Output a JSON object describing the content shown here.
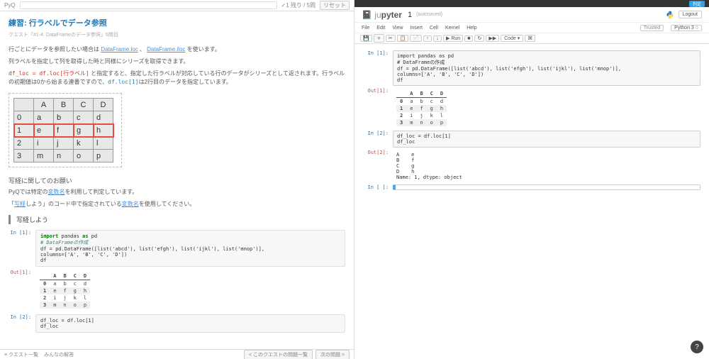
{
  "left": {
    "logo": "PyQ",
    "progress": "1 残り / 5問",
    "reset": "リセット",
    "title": "練習: 行ラベルでデータ参照",
    "breadcrumb": "クエスト「#1-4. DataFrameのデータ参照」5問目",
    "p1_pre": "行ごとにデータを参照したい場合は ",
    "p1_link1": "DataFrame.loc",
    "p1_mid": " 、 ",
    "p1_link2": "DataFrame.iloc",
    "p1_post": " を使います。",
    "p2": "列ラベルを指定して列を取得した時と同様にシリーズを取得できます。",
    "p3a": "df_loc = df.loc[行ラベル]",
    "p3b": " と指定すると、指定した行ラベルが対応している行のデータがシリーズとして返されます。行ラベルの初期値は0から始まる連番ですので、",
    "p3c": "df.loc[1]",
    "p3d": "は2行目のデータを指定しています。",
    "bigtable": {
      "header": [
        "",
        "A",
        "B",
        "C",
        "D"
      ],
      "rows": [
        [
          "0",
          "a",
          "b",
          "c",
          "d"
        ],
        [
          "1",
          "e",
          "f",
          "g",
          "h"
        ],
        [
          "2",
          "i",
          "j",
          "k",
          "l"
        ],
        [
          "3",
          "m",
          "n",
          "o",
          "p"
        ]
      ],
      "highlight_row": 1
    },
    "note_h": "写経に関してのお願い",
    "note1a": "PyQでは特定の",
    "note1b": "変数名",
    "note1c": "を利用して判定しています。",
    "note2a": "「",
    "note2b": "写経",
    "note2c": "しよう」のコード中で指定されている",
    "note2d": "変数名",
    "note2e": "を使用してください。",
    "quote": "写経しよう",
    "cell_in1": {
      "prompt": "In [1]:",
      "l1a": "import",
      "l1b": " pandas ",
      "l1c": "as",
      "l1d": " pd",
      "l2": "# DataFrameの作成",
      "l3": "df = pd.DataFrame([list('abcd'), list('efgh'), list('ijkl'), list('mnop')],",
      "l4": "                  columns=['A', 'B', 'C', 'D'])",
      "l5": "df"
    },
    "cell_out1": {
      "prompt": "Out[1]:",
      "cols": [
        "",
        "A",
        "B",
        "C",
        "D"
      ],
      "rows": [
        [
          "0",
          "a",
          "b",
          "c",
          "d"
        ],
        [
          "1",
          "e",
          "f",
          "g",
          "h"
        ],
        [
          "2",
          "i",
          "j",
          "k",
          "l"
        ],
        [
          "3",
          "m",
          "n",
          "o",
          "p"
        ]
      ]
    },
    "cell_in2": {
      "prompt": "In [2]:",
      "l1": "df_loc = df.loc[1]",
      "l2": "df_loc"
    },
    "footer": {
      "quest_list": "クエスト一覧",
      "everyone": "みんなの解答",
      "prev": "< このクエストの問題一覧",
      "next": "次の問題 >"
    }
  },
  "right": {
    "topbadge": "判定",
    "logo_a": "ju",
    "logo_b": "pyter",
    "nbname": "1",
    "autosaved": "(autosaved)",
    "logout": "Logout",
    "menu": [
      "File",
      "Edit",
      "View",
      "Insert",
      "Cell",
      "Kernel",
      "Help"
    ],
    "trusted": "Trusted",
    "kernel": "Python 3",
    "tool_run": "▶ Run",
    "tool_celltype": "Code",
    "cell_in1": {
      "prompt": "In [1]:",
      "l1a": "import",
      "l1b": " pandas ",
      "l1c": "as",
      "l1d": " pd",
      "l2": "# DataFrameの作成",
      "l3": "df = pd.DataFrame([list('abcd'), list('efgh'), list('ijkl'), list('mnop')],",
      "l4": "                  columns=['A', 'B', 'C', 'D'])",
      "l5": "df"
    },
    "cell_out1": {
      "prompt": "Out[1]:",
      "cols": [
        "",
        "A",
        "B",
        "C",
        "D"
      ],
      "rows": [
        [
          "0",
          "a",
          "b",
          "c",
          "d"
        ],
        [
          "1",
          "e",
          "f",
          "g",
          "h"
        ],
        [
          "2",
          "i",
          "j",
          "k",
          "l"
        ],
        [
          "3",
          "m",
          "n",
          "o",
          "p"
        ]
      ]
    },
    "cell_in2": {
      "prompt": "In [2]:",
      "l1": "df_loc = df.loc[1]",
      "l2": "df_loc"
    },
    "cell_out2": {
      "prompt": "Out[2]:",
      "lines": [
        "A    e",
        "B    f",
        "C    g",
        "D    h",
        "Name: 1, dtype: object"
      ]
    },
    "cell_in3": {
      "prompt": "In [ ]:",
      "body": ""
    }
  },
  "help": "?"
}
